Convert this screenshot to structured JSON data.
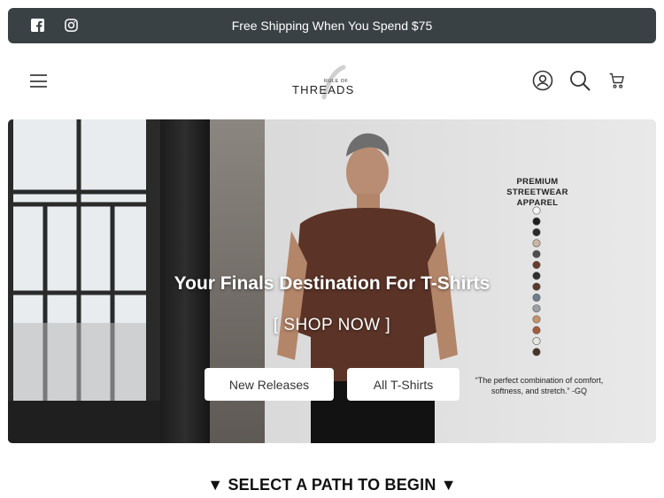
{
  "announcement": {
    "text": "Free Shipping When You Spend $75",
    "social": [
      "facebook-icon",
      "instagram-icon"
    ]
  },
  "header": {
    "logo": {
      "top": "RULE OF",
      "main": "THREADS"
    },
    "icons": [
      "account-icon",
      "search-icon",
      "cart-icon"
    ]
  },
  "hero": {
    "title": "Your Finals Destination For T-Shirts",
    "cta": "[ SHOP NOW ]",
    "buttons": {
      "new_releases": "New Releases",
      "all_tshirts": "All T-Shirts"
    },
    "side_heading": {
      "line1": "PREMIUM STREETWEAR",
      "line2": "APPAREL"
    },
    "swatches": [
      "#f3f3f3",
      "#1e1e1e",
      "#2b2b2b",
      "#c9b6a4",
      "#4d4d4d",
      "#6b3b2a",
      "#2f2f2f",
      "#5a3a2c",
      "#6f7d8c",
      "#9aa0a6",
      "#c8926a",
      "#a85a3a",
      "#e9e6e2",
      "#4a3228"
    ],
    "quote": {
      "line1": "“The perfect combination of comfort,",
      "line2": "softness, and stretch.” -GQ"
    }
  },
  "section": {
    "select_path": "▼ SELECT A PATH TO BEGIN ▼"
  },
  "colors": {
    "announcement_bg": "#3a4145",
    "shirt": "#5b3327"
  }
}
